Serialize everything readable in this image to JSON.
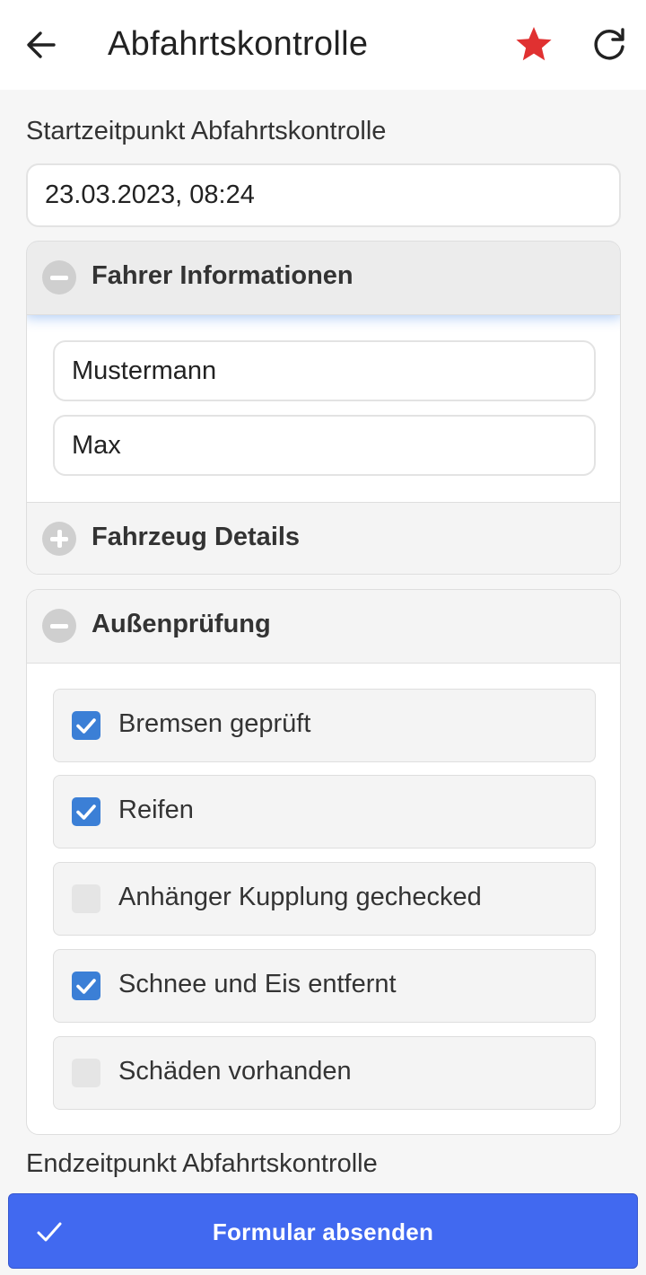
{
  "header": {
    "title": "Abfahrtskontrolle",
    "icons": [
      "arrow-left-icon",
      "star-icon",
      "refresh-icon"
    ],
    "star_color": "#e03131"
  },
  "form": {
    "start_label": "Startzeitpunkt Abfahrtskontrolle",
    "start_value": "23.03.2023, 08:24",
    "end_label": "Endzeitpunkt Abfahrtskontrolle"
  },
  "sections": {
    "driver": {
      "title": "Fahrer Informationen",
      "expanded": true,
      "lastname": "Mustermann",
      "firstname": "Max"
    },
    "vehicle": {
      "title": "Fahrzeug Details",
      "expanded": false
    },
    "exterior": {
      "title": "Außenprüfung",
      "expanded": true,
      "items": [
        {
          "label": "Bremsen geprüft",
          "checked": true
        },
        {
          "label": "Reifen",
          "checked": true
        },
        {
          "label": "Anhänger Kupplung gechecked",
          "checked": false
        },
        {
          "label": "Schnee und Eis entfernt",
          "checked": true
        },
        {
          "label": "Schäden vorhanden",
          "checked": false
        }
      ]
    }
  },
  "submit": {
    "label": "Formular absenden",
    "color": "#4169f0"
  }
}
